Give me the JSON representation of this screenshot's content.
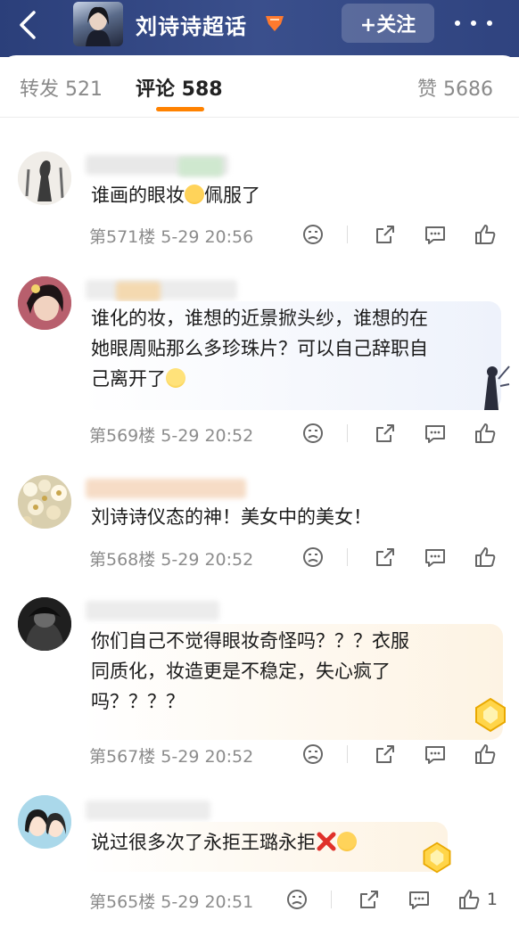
{
  "header": {
    "title": "刘诗诗超话",
    "follow_label": "+关注"
  },
  "tabs": [
    {
      "label": "转发 521"
    },
    {
      "label": "评论 588"
    },
    {
      "label": "赞 5686"
    }
  ],
  "comments": [
    {
      "text": [
        "谁画的眼妆",
        "佩服了"
      ],
      "meta": "第571楼  5-29 20:56",
      "likes": ""
    },
    {
      "text": [
        "谁化的妆，谁想的近景掀头纱，谁想的在",
        "她眼周贴那么多珍珠片？可以自己辞职自",
        "己离开了"
      ],
      "meta": "第569楼  5-29 20:52",
      "likes": ""
    },
    {
      "text": [
        "刘诗诗仪态的神！美女中的美女！"
      ],
      "meta": "第568楼  5-29 20:52",
      "likes": ""
    },
    {
      "text": [
        "你们自己不觉得眼妆奇怪吗？？？衣服",
        "同质化，妆造更是不稳定，失心疯了",
        "吗？？？？"
      ],
      "meta": "第567楼  5-29 20:52",
      "likes": ""
    },
    {
      "text": [
        "说过很多次了永拒王璐永拒"
      ],
      "meta": "第565楼  5-29 20:51",
      "likes": "1"
    }
  ],
  "colors": {
    "header_bg": "#2f437f",
    "accent": "#ff8200",
    "meta_text": "#8c8c8c"
  },
  "icons": [
    "back-icon",
    "more-icon",
    "dislike-icon",
    "share-icon",
    "comment-icon",
    "like-icon"
  ]
}
